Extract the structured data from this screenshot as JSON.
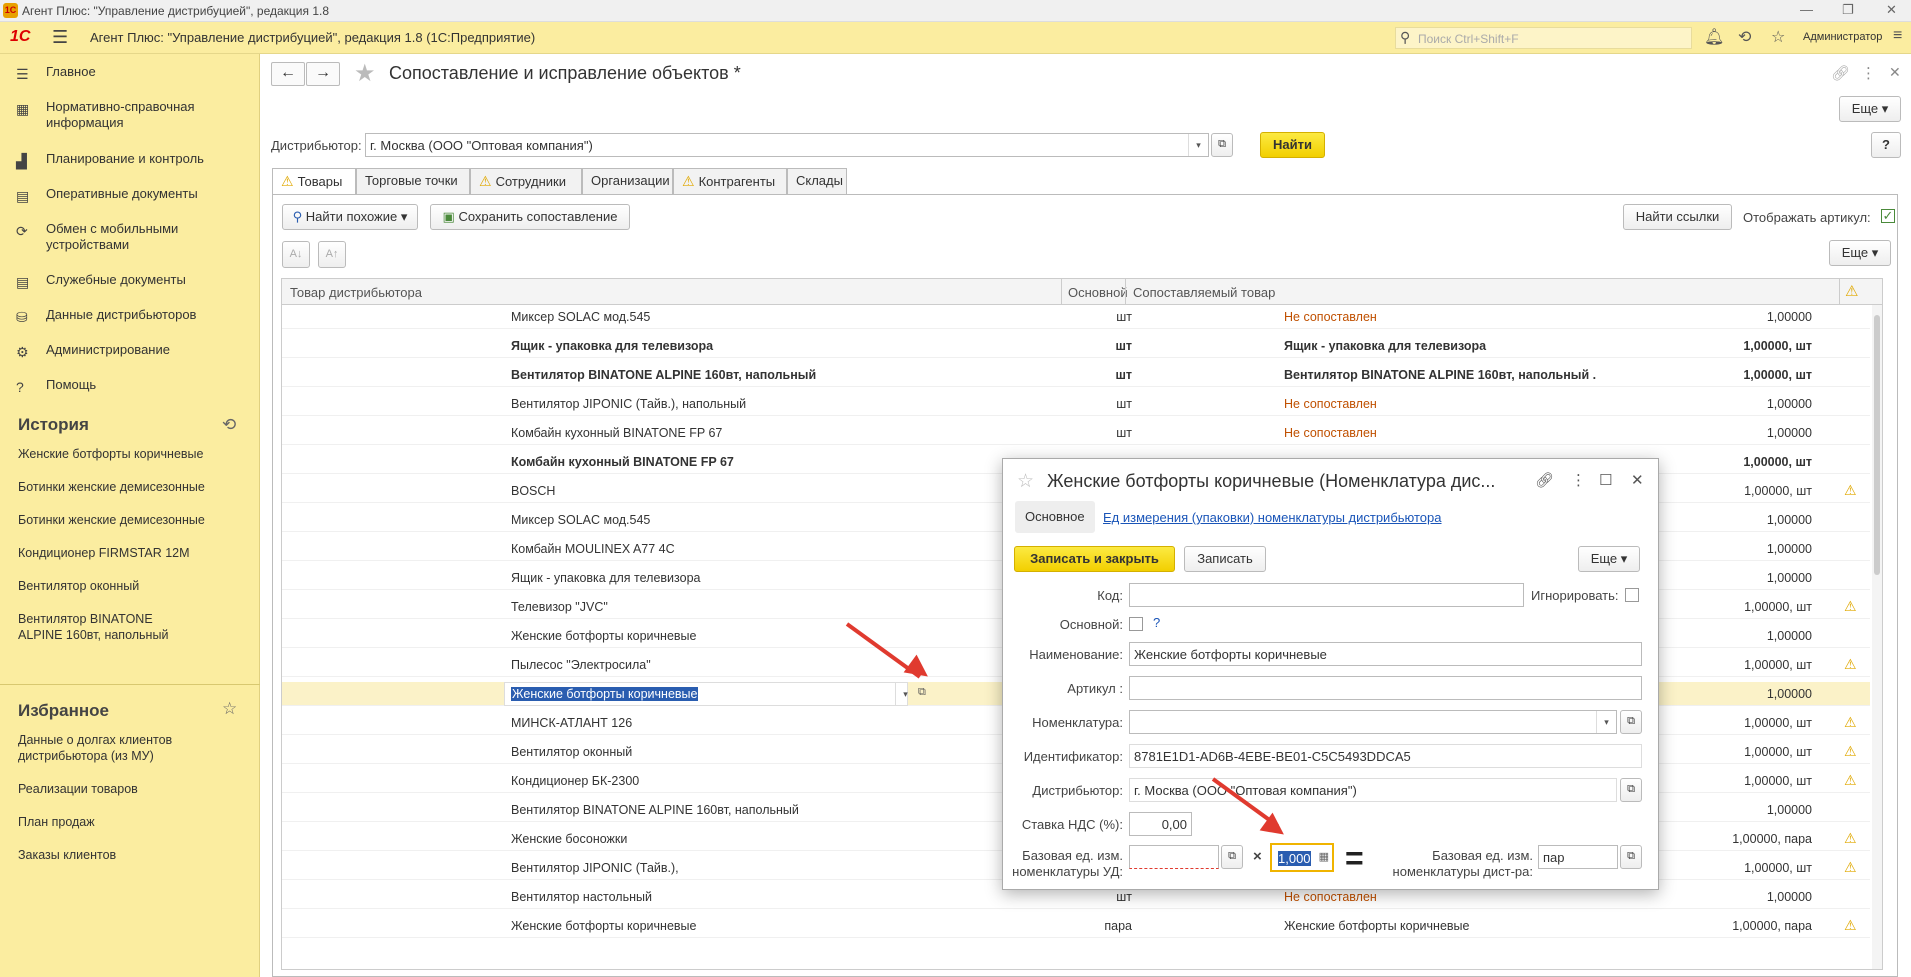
{
  "window": {
    "title": "Агент Плюс: \"Управление дистрибуцией\", редакция 1.8"
  },
  "appbar": {
    "logo": "1С",
    "title": "Агент Плюс: \"Управление дистрибуцией\", редакция 1.8  (1С:Предприятие)",
    "search_placeholder": "Поиск Ctrl+Shift+F",
    "user": "Администратор"
  },
  "sidebar": {
    "items": [
      {
        "label": "Главное",
        "icon": "menu-icon"
      },
      {
        "label": "Нормативно-справочная информация",
        "icon": "table-icon"
      },
      {
        "label": "Планирование и контроль",
        "icon": "chart-icon"
      },
      {
        "label": "Оперативные документы",
        "icon": "documents-icon"
      },
      {
        "label": "Обмен с мобильными устройствами",
        "icon": "sync-icon"
      },
      {
        "label": "Служебные документы",
        "icon": "documents-icon"
      },
      {
        "label": "Данные дистрибьюторов",
        "icon": "data-icon"
      },
      {
        "label": "Администрирование",
        "icon": "gear-icon"
      },
      {
        "label": "Помощь",
        "icon": "help-icon"
      }
    ],
    "history_title": "История",
    "history": [
      "Женские ботфорты коричневые",
      "Ботинки женские демисезонные",
      "Ботинки женские демисезонные",
      "Кондиционер FIRMSTAR 12M",
      "Вентилятор оконный",
      "Вентилятор BINATONE ALPINE 160вт, напольный"
    ],
    "favorites_title": "Избранное",
    "favorites": [
      "Данные о долгах клиентов дистрибьютора (из МУ)",
      "Реализации товаров",
      "План продаж",
      "Заказы клиентов"
    ]
  },
  "form": {
    "title": "Сопоставление и исправление объектов *",
    "more": "Еще",
    "distributor_label": "Дистрибьютор:",
    "distributor_value": "г. Москва  (ООО \"Оптовая компания\")",
    "find_button": "Найти",
    "help_button": "?",
    "tabs": [
      "Товары",
      "Торговые точки",
      "Сотрудники",
      "Организации",
      "Контрагенты",
      "Склады"
    ],
    "find_similar": "Найти похожие",
    "save_mapping": "Сохранить сопоставление",
    "find_links": "Найти ссылки",
    "show_article": "Отображать артикул:",
    "more2": "Еще"
  },
  "grid": {
    "headers": [
      "Товар дистрибьютора",
      "Основной",
      "Сопоставляемый товар"
    ],
    "rows": [
      {
        "name": "Миксер SOLAC мод.545",
        "unit": "шт",
        "match": "Не сопоставлен",
        "qty": "1,00000",
        "warn": false,
        "bold": false,
        "red": true
      },
      {
        "name": "Ящик - упаковка для телевизора",
        "unit": "шт",
        "match": "Ящик - упаковка для телевизора",
        "qty": "1,00000, шт",
        "warn": false,
        "bold": true,
        "red": false
      },
      {
        "name": "Вентилятор BINATONE ALPINE 160вт, напольный",
        "unit": "шт",
        "match": "Вентилятор BINATONE ALPINE 160вт, напольный  .",
        "qty": "1,00000, шт",
        "warn": false,
        "bold": true,
        "red": false
      },
      {
        "name": "Вентилятор JIPONIC (Тайв.), напольный",
        "unit": "шт",
        "match": "Не сопоставлен",
        "qty": "1,00000",
        "warn": false,
        "bold": false,
        "red": true
      },
      {
        "name": "Комбайн кухонный BINATONE FP 67",
        "unit": "шт",
        "match": "Не сопоставлен",
        "qty": "1,00000",
        "warn": false,
        "bold": false,
        "red": true
      },
      {
        "name": "Комбайн кухонный BINATONE FP 67",
        "unit": "",
        "match": "",
        "qty": "1,00000, шт",
        "warn": false,
        "bold": true,
        "red": false
      },
      {
        "name": "BOSCH",
        "unit": "",
        "match": "",
        "qty": "1,00000, шт",
        "warn": true,
        "bold": false,
        "red": false
      },
      {
        "name": "Миксер SOLAC мод.545",
        "unit": "",
        "match": "",
        "qty": "1,00000",
        "warn": false,
        "bold": false,
        "red": false
      },
      {
        "name": "Комбайн MOULINEX  A77 4C",
        "unit": "",
        "match": "",
        "qty": "1,00000",
        "warn": false,
        "bold": false,
        "red": false
      },
      {
        "name": "Ящик - упаковка для телевизора",
        "unit": "",
        "match": "",
        "qty": "1,00000",
        "warn": false,
        "bold": false,
        "red": false
      },
      {
        "name": "Телевизор \"JVC\"",
        "unit": "",
        "match": "",
        "qty": "1,00000, шт",
        "warn": true,
        "bold": false,
        "red": false
      },
      {
        "name": "Женские ботфорты коричневые",
        "unit": "",
        "match": "",
        "qty": "1,00000",
        "warn": false,
        "bold": false,
        "red": false
      },
      {
        "name": "Пылесос \"Электросила\"",
        "unit": "",
        "match": "",
        "qty": "1,00000, шт",
        "warn": true,
        "bold": false,
        "red": false
      },
      {
        "name": "Женские ботфорты коричневые",
        "unit": "",
        "match": "",
        "qty": "1,00000",
        "warn": false,
        "bold": false,
        "red": false,
        "selected": true
      },
      {
        "name": "МИНСК-АТЛАНТ 126",
        "unit": "",
        "match": "",
        "qty": "1,00000, шт",
        "warn": true,
        "bold": false,
        "red": false
      },
      {
        "name": "Вентилятор оконный",
        "unit": "",
        "match": "",
        "qty": "1,00000, шт",
        "warn": true,
        "bold": false,
        "red": false
      },
      {
        "name": "Кондиционер БК-2300",
        "unit": "",
        "match": "",
        "qty": "1,00000, шт",
        "warn": true,
        "bold": false,
        "red": false
      },
      {
        "name": "Вентилятор BINATONE ALPINE 160вт, напольный",
        "unit": "",
        "match": "",
        "qty": "1,00000",
        "warn": false,
        "bold": false,
        "red": false
      },
      {
        "name": "Женские босоножки",
        "unit": "",
        "match": "",
        "qty": "1,00000, пара",
        "warn": true,
        "bold": false,
        "red": false
      },
      {
        "name": "Вентилятор JIPONIC (Тайв.),",
        "unit": "",
        "match": "",
        "qty": "1,00000, шт",
        "warn": true,
        "bold": false,
        "red": false
      },
      {
        "name": "Вентилятор настольный",
        "unit": "шт",
        "match": "Не сопоставлен",
        "qty": "1,00000",
        "warn": false,
        "bold": false,
        "red": true
      },
      {
        "name": "Женские ботфорты коричневые",
        "unit": "пара",
        "match": "Женские ботфорты коричневые",
        "qty": "1,00000, пара",
        "warn": true,
        "bold": false,
        "red": false
      }
    ]
  },
  "dialog": {
    "title": "Женские ботфорты коричневые (Номенклатура дис...",
    "tab_main": "Основное",
    "tab_units": "Ед измерения (упаковки)  номенклатуры дистрибьютора",
    "save_close": "Записать и закрыть",
    "save": "Записать",
    "more": "Еще",
    "code_label": "Код:",
    "ignore_label": "Игнорировать:",
    "main_label": "Основной:",
    "main_help": "?",
    "name_label": "Наименование:",
    "name_value": "Женские ботфорты коричневые",
    "article_label": "Артикул :",
    "nomen_label": "Номенклатура:",
    "id_label": "Идентификатор:",
    "id_value": "8781E1D1-AD6B-4EBE-BE01-C5C5493DDCA5",
    "distr_label": "Дистрибьютор:",
    "distr_value": "г. Москва  (ООО \"Оптовая компания\")",
    "vat_label": "Ставка НДС (%):",
    "vat_value": "0,00",
    "base_ud_label1": "Базовая ед. изм.",
    "base_ud_label2": "номенклатуры УД:",
    "multiply": "×",
    "coef_value": "1,000",
    "equals": "=",
    "base_d_label1": "Базовая ед. изм.",
    "base_d_label2": "номенклатуры дист-ра:",
    "base_d_value": "пар"
  }
}
